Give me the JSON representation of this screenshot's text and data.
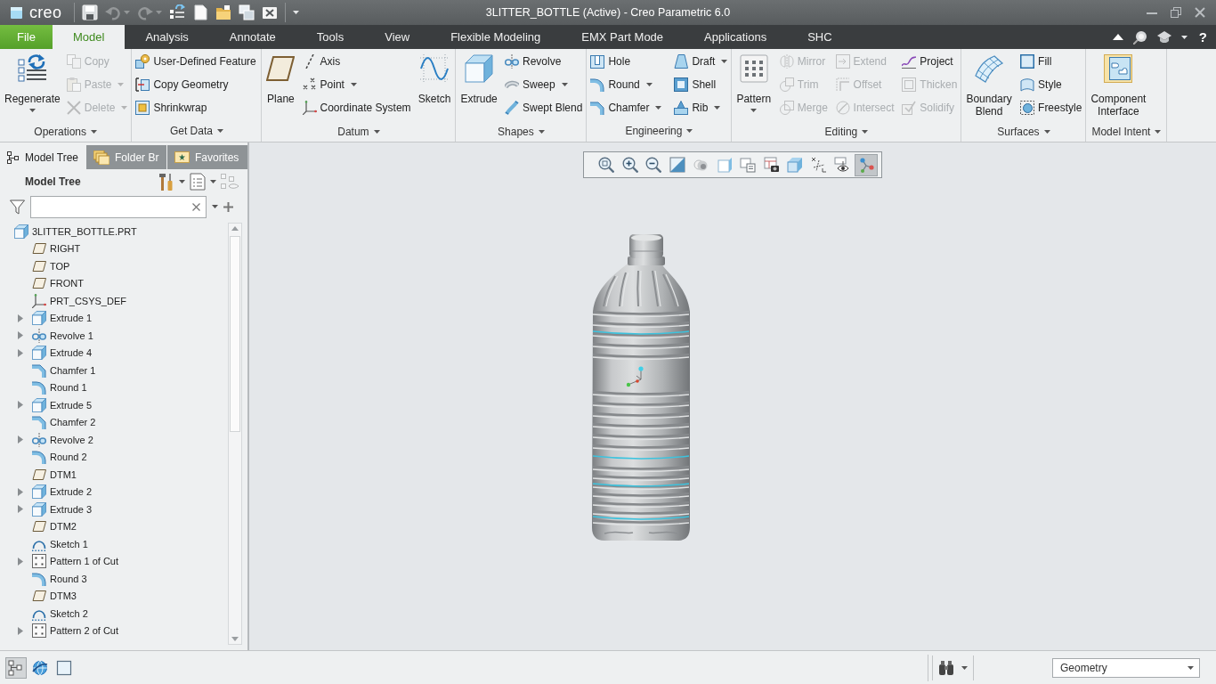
{
  "window": {
    "logo": "creo",
    "title": "3LITTER_BOTTLE (Active) - Creo Parametric 6.0"
  },
  "quick_access": [
    {
      "disabled": false
    },
    {
      "disabled": true
    },
    {
      "disabled": true
    },
    {
      "disabled": false
    },
    {
      "disabled": false
    },
    {
      "disabled": false
    },
    {
      "disabled": false
    },
    {
      "disabled": false
    }
  ],
  "tabs": [
    {
      "label": "File",
      "kind": "file",
      "selected": false
    },
    {
      "label": "Model",
      "kind": "tab",
      "selected": true
    },
    {
      "label": "Analysis",
      "kind": "tab",
      "selected": false
    },
    {
      "label": "Annotate",
      "kind": "tab",
      "selected": false
    },
    {
      "label": "Tools",
      "kind": "tab",
      "selected": false
    },
    {
      "label": "View",
      "kind": "tab",
      "selected": false
    },
    {
      "label": "Flexible Modeling",
      "kind": "tab",
      "selected": false
    },
    {
      "label": "EMX Part Mode",
      "kind": "tab",
      "selected": false
    },
    {
      "label": "Applications",
      "kind": "tab",
      "selected": false
    },
    {
      "label": "SHC",
      "kind": "tab",
      "selected": false
    }
  ],
  "help": "?",
  "ribbon": {
    "groups": [
      {
        "label": "Operations",
        "columns": [
          {
            "kind": "large",
            "items": [
              {
                "label": "Regenerate",
                "menu": true,
                "disabled": false
              }
            ]
          },
          {
            "kind": "stack",
            "items": [
              {
                "label": "Copy",
                "menu": false,
                "disabled": true
              },
              {
                "label": "Paste",
                "menu": true,
                "disabled": true
              },
              {
                "label": "Delete",
                "menu": true,
                "disabled": true
              }
            ]
          }
        ]
      },
      {
        "label": "Get Data",
        "columns": [
          {
            "kind": "stack",
            "items": [
              {
                "label": "User-Defined Feature",
                "menu": false,
                "disabled": false
              },
              {
                "label": "Copy Geometry",
                "menu": false,
                "disabled": false
              },
              {
                "label": "Shrinkwrap",
                "menu": false,
                "disabled": false
              }
            ]
          }
        ]
      },
      {
        "label": "Datum",
        "columns": [
          {
            "kind": "large",
            "items": [
              {
                "label": "Plane",
                "menu": false,
                "disabled": false
              }
            ]
          },
          {
            "kind": "stack",
            "items": [
              {
                "label": "Axis",
                "menu": false,
                "disabled": false
              },
              {
                "label": "Point",
                "menu": true,
                "disabled": false
              },
              {
                "label": "Coordinate System",
                "menu": false,
                "disabled": false
              }
            ]
          },
          {
            "kind": "large",
            "items": [
              {
                "label": "Sketch",
                "menu": false,
                "disabled": false
              }
            ]
          }
        ]
      },
      {
        "label": "Shapes",
        "columns": [
          {
            "kind": "large",
            "items": [
              {
                "label": "Extrude",
                "menu": false,
                "disabled": false
              }
            ]
          },
          {
            "kind": "stack",
            "items": [
              {
                "label": "Revolve",
                "menu": false,
                "disabled": false
              },
              {
                "label": "Sweep",
                "menu": true,
                "disabled": false
              },
              {
                "label": "Swept Blend",
                "menu": false,
                "disabled": false
              }
            ]
          }
        ]
      },
      {
        "label": "Engineering",
        "columns": [
          {
            "kind": "stack",
            "items": [
              {
                "label": "Hole",
                "menu": false,
                "disabled": false
              },
              {
                "label": "Round",
                "menu": true,
                "disabled": false
              },
              {
                "label": "Chamfer",
                "menu": true,
                "disabled": false
              }
            ]
          },
          {
            "kind": "stack",
            "items": [
              {
                "label": "Draft",
                "menu": true,
                "disabled": false
              },
              {
                "label": "Shell",
                "menu": false,
                "disabled": false
              },
              {
                "label": "Rib",
                "menu": true,
                "disabled": false
              }
            ]
          }
        ]
      },
      {
        "label": "Editing",
        "columns": [
          {
            "kind": "large",
            "items": [
              {
                "label": "Pattern",
                "menu": true,
                "disabled": false
              }
            ]
          },
          {
            "kind": "stack",
            "items": [
              {
                "label": "Mirror",
                "menu": false,
                "disabled": true
              },
              {
                "label": "Trim",
                "menu": false,
                "disabled": true
              },
              {
                "label": "Merge",
                "menu": false,
                "disabled": true
              }
            ]
          },
          {
            "kind": "stack",
            "items": [
              {
                "label": "Extend",
                "menu": false,
                "disabled": true
              },
              {
                "label": "Offset",
                "menu": false,
                "disabled": true
              },
              {
                "label": "Intersect",
                "menu": false,
                "disabled": true
              }
            ]
          },
          {
            "kind": "stack",
            "items": [
              {
                "label": "Project",
                "menu": false,
                "disabled": false
              },
              {
                "label": "Thicken",
                "menu": false,
                "disabled": true
              },
              {
                "label": "Solidify",
                "menu": false,
                "disabled": true
              }
            ]
          }
        ]
      },
      {
        "label": "Surfaces",
        "columns": [
          {
            "kind": "large",
            "items": [
              {
                "label": "Boundary Blend",
                "menu": false,
                "disabled": false
              }
            ]
          },
          {
            "kind": "stack",
            "items": [
              {
                "label": "Fill",
                "menu": false,
                "disabled": false
              },
              {
                "label": "Style",
                "menu": false,
                "disabled": false
              },
              {
                "label": "Freestyle",
                "menu": false,
                "disabled": false
              }
            ]
          }
        ]
      },
      {
        "label": "Model Intent",
        "columns": [
          {
            "kind": "large",
            "items": [
              {
                "label": "Component Interface",
                "menu": false,
                "disabled": false
              }
            ]
          }
        ]
      }
    ]
  },
  "model_tree": {
    "tabs": [
      {
        "label": "Model Tree",
        "selected": true
      },
      {
        "label": "Folder Br",
        "selected": false
      },
      {
        "label": "Favorites",
        "selected": false
      }
    ],
    "title": "Model Tree",
    "items": [
      {
        "label": "3LITTER_BOTTLE.PRT",
        "kind": "part",
        "expandable": false,
        "children": [
          {
            "label": "RIGHT",
            "kind": "plane",
            "expandable": false
          },
          {
            "label": "TOP",
            "kind": "plane",
            "expandable": false
          },
          {
            "label": "FRONT",
            "kind": "plane",
            "expandable": false
          },
          {
            "label": "PRT_CSYS_DEF",
            "kind": "csys",
            "expandable": false
          },
          {
            "label": "Extrude 1",
            "kind": "extrude",
            "expandable": true
          },
          {
            "label": "Revolve 1",
            "kind": "revolve",
            "expandable": true
          },
          {
            "label": "Extrude 4",
            "kind": "extrude",
            "expandable": true
          },
          {
            "label": "Chamfer 1",
            "kind": "chamfer",
            "expandable": false
          },
          {
            "label": "Round 1",
            "kind": "round",
            "expandable": false
          },
          {
            "label": "Extrude 5",
            "kind": "extrude",
            "expandable": true
          },
          {
            "label": "Chamfer 2",
            "kind": "chamfer",
            "expandable": false
          },
          {
            "label": "Revolve 2",
            "kind": "revolve",
            "expandable": true
          },
          {
            "label": "Round 2",
            "kind": "round",
            "expandable": false
          },
          {
            "label": "DTM1",
            "kind": "plane",
            "expandable": false
          },
          {
            "label": "Extrude 2",
            "kind": "extrude",
            "expandable": true
          },
          {
            "label": "Extrude 3",
            "kind": "extrude",
            "expandable": true
          },
          {
            "label": "DTM2",
            "kind": "plane",
            "expandable": false
          },
          {
            "label": "Sketch 1",
            "kind": "sketch",
            "expandable": false
          },
          {
            "label": "Pattern 1 of Cut",
            "kind": "pattern",
            "expandable": true
          },
          {
            "label": "Round 3",
            "kind": "round",
            "expandable": false
          },
          {
            "label": "DTM3",
            "kind": "plane",
            "expandable": false
          },
          {
            "label": "Sketch 2",
            "kind": "sketch",
            "expandable": false
          },
          {
            "label": "Pattern 2 of Cut",
            "kind": "pattern",
            "expandable": true
          }
        ]
      }
    ]
  },
  "view_toolbar": [
    {
      "selected": false
    },
    {
      "selected": false
    },
    {
      "selected": false
    },
    {
      "selected": false
    },
    {
      "selected": false
    },
    {
      "selected": false
    },
    {
      "selected": false
    },
    {
      "selected": false
    },
    {
      "selected": false
    },
    {
      "selected": false
    },
    {
      "selected": false
    },
    {
      "selected": true
    }
  ],
  "status_bar": {
    "toggles": [
      {
        "selected": true
      },
      {
        "selected": false
      },
      {
        "selected": false
      }
    ],
    "selection_filter": "Geometry"
  }
}
